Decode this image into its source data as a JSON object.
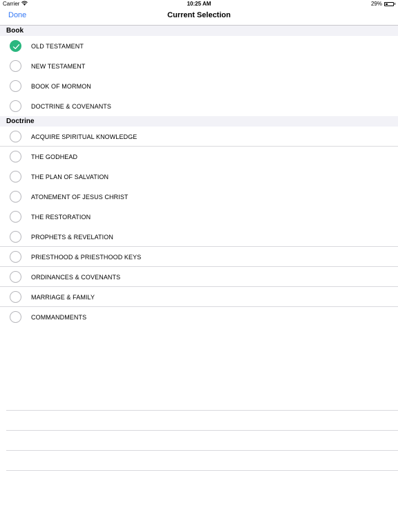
{
  "status_bar": {
    "carrier": "Carrier",
    "time": "10:25 AM",
    "battery_percent": "29%",
    "battery_level": 0.29
  },
  "nav": {
    "done_label": "Done",
    "title": "Current Selection"
  },
  "sections": [
    {
      "header": "Book",
      "items": [
        {
          "label": "OLD TESTAMENT",
          "checked": true
        },
        {
          "label": "NEW TESTAMENT",
          "checked": false
        },
        {
          "label": "BOOK OF MORMON",
          "checked": false
        },
        {
          "label": "DOCTRINE & COVENANTS",
          "checked": false
        }
      ]
    },
    {
      "header": "Doctrine",
      "items": [
        {
          "label": "ACQUIRE SPIRITUAL KNOWLEDGE",
          "checked": false
        },
        {
          "label": "THE GODHEAD",
          "checked": false
        },
        {
          "label": "THE PLAN OF SALVATION",
          "checked": false
        },
        {
          "label": "ATONEMENT OF JESUS CHRIST",
          "checked": false
        },
        {
          "label": "THE RESTORATION",
          "checked": false
        },
        {
          "label": "PROPHETS & REVELATION",
          "checked": false
        },
        {
          "label": "PRIESTHOOD & PRIESTHOOD KEYS",
          "checked": false
        },
        {
          "label": "ORDINANCES & COVENANTS",
          "checked": false
        },
        {
          "label": "MARRIAGE & FAMILY",
          "checked": false
        },
        {
          "label": "COMMANDMENTS",
          "checked": false
        }
      ]
    }
  ],
  "colors": {
    "accent": "#3478f6",
    "checked": "#2ab77f"
  }
}
